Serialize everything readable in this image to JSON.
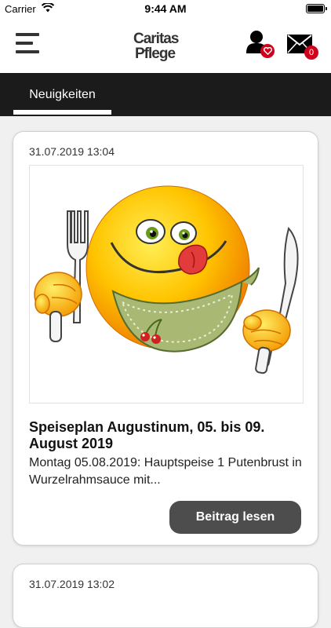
{
  "status_bar": {
    "carrier": "Carrier",
    "time": "9:44 AM"
  },
  "header": {
    "logo_line1": "Caritas",
    "logo_line2": "Pflege",
    "favorites_count": "",
    "mail_count": "0"
  },
  "tabs": [
    {
      "label": "Neuigkeiten",
      "active": true
    }
  ],
  "posts": [
    {
      "date": "31.07.2019 13:04",
      "image_icon": "smiley-eating-icon",
      "title": "Speiseplan Augustinum, 05. bis 09. August 2019",
      "excerpt": "Montag 05.08.2019: Hauptspeise 1 Putenbrust in Wurzelrahmsauce mit...",
      "button_label": "Beitrag lesen"
    },
    {
      "date": "31.07.2019 13:02"
    }
  ],
  "colors": {
    "tabbar_bg": "#1b1b1b",
    "badge": "#d0021b",
    "button_bg": "#4d4d4d",
    "page_bg": "#f0f0f0"
  }
}
